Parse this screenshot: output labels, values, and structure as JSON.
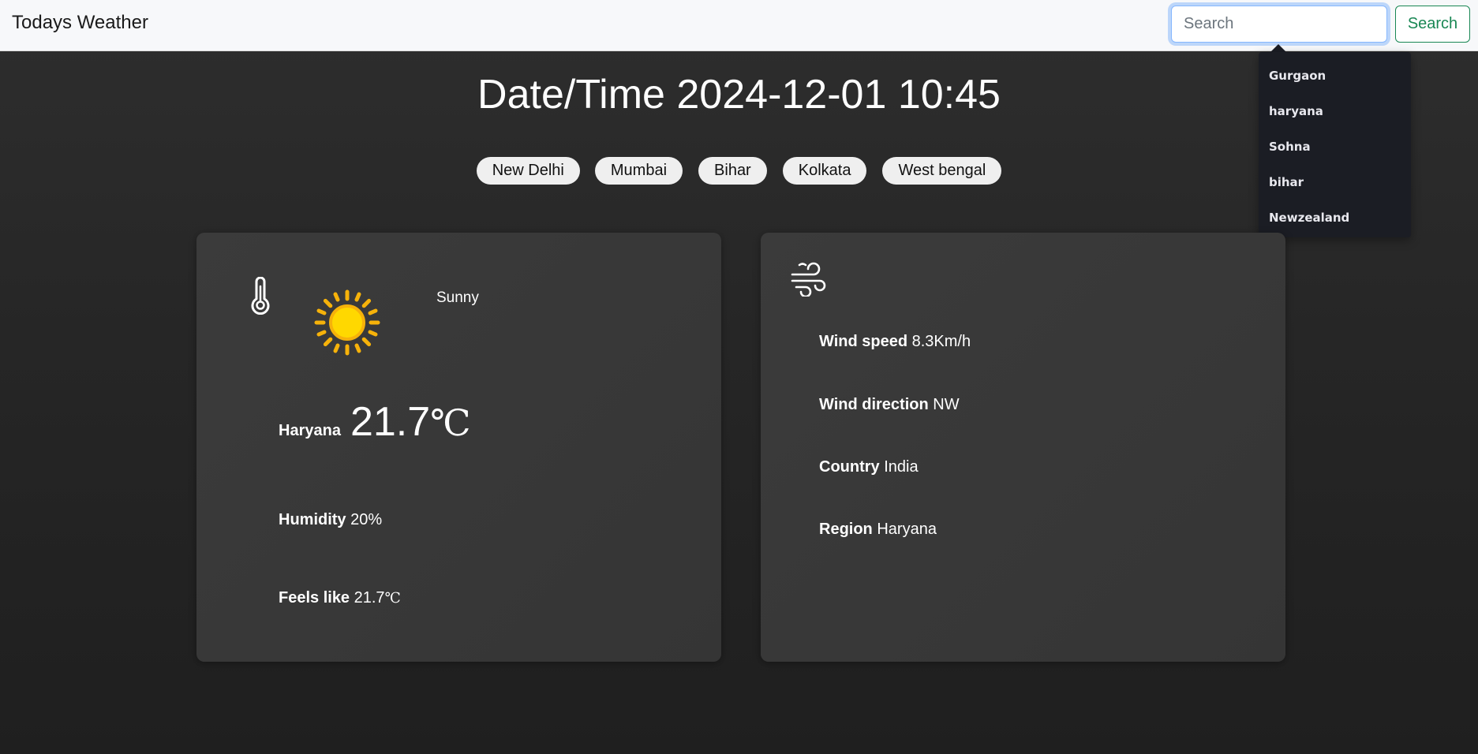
{
  "navbar": {
    "brand": "Todays Weather",
    "search_placeholder": "Search",
    "search_value": "",
    "search_button": "Search"
  },
  "suggestions": [
    "Gurgaon",
    "haryana",
    "Sohna",
    "bihar",
    "Newzealand"
  ],
  "datetime": "Date/Time 2024-12-01 10:45",
  "cities": [
    "New Delhi",
    "Mumbai",
    "Bihar",
    "Kolkata",
    "West bengal"
  ],
  "weather": {
    "condition": "Sunny",
    "location": "Haryana",
    "temperature": "21.7",
    "temperature_unit": "℃",
    "humidity_label": "Humidity",
    "humidity": "20%",
    "feels_like_label": "Feels like",
    "feels_like": "21.7",
    "feels_like_unit": "℃"
  },
  "wind": {
    "speed_label": "Wind speed",
    "speed": "8.3Km/h",
    "direction_label": "Wind direction",
    "direction": "NW",
    "country_label": "Country",
    "country": "India",
    "region_label": "Region",
    "region": "Haryana"
  },
  "icons": {
    "thermometer": "thermometer-icon",
    "sun": "sun-icon",
    "wind": "wind-icon"
  },
  "colors": {
    "sun_core": "#ffd800",
    "sun_ray": "#f6b20a",
    "search_accent": "#198754",
    "focus_ring": "#86b7fe"
  }
}
